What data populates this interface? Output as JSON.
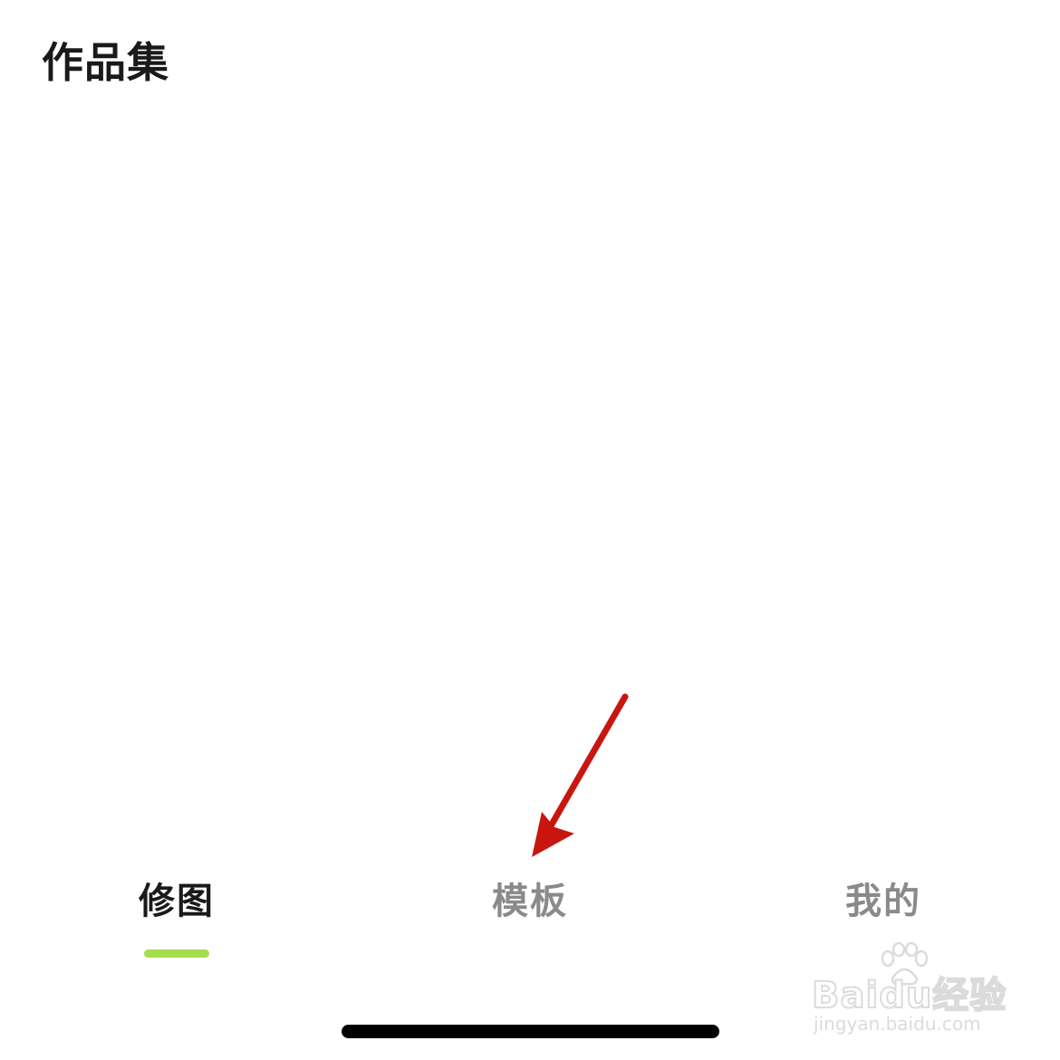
{
  "header": {
    "title": "作品集"
  },
  "tabs": [
    {
      "label": "修图",
      "active": true
    },
    {
      "label": "模板",
      "active": false
    },
    {
      "label": "我的",
      "active": false
    }
  ],
  "colors": {
    "active_indicator": "#a5dd4f",
    "active_text": "#1a1a1a",
    "inactive_text": "#8a8a8a",
    "annotation_arrow": "#c8160f"
  },
  "watermark": {
    "logo": "Baidu经验",
    "url": "jingyan.baidu.com"
  }
}
